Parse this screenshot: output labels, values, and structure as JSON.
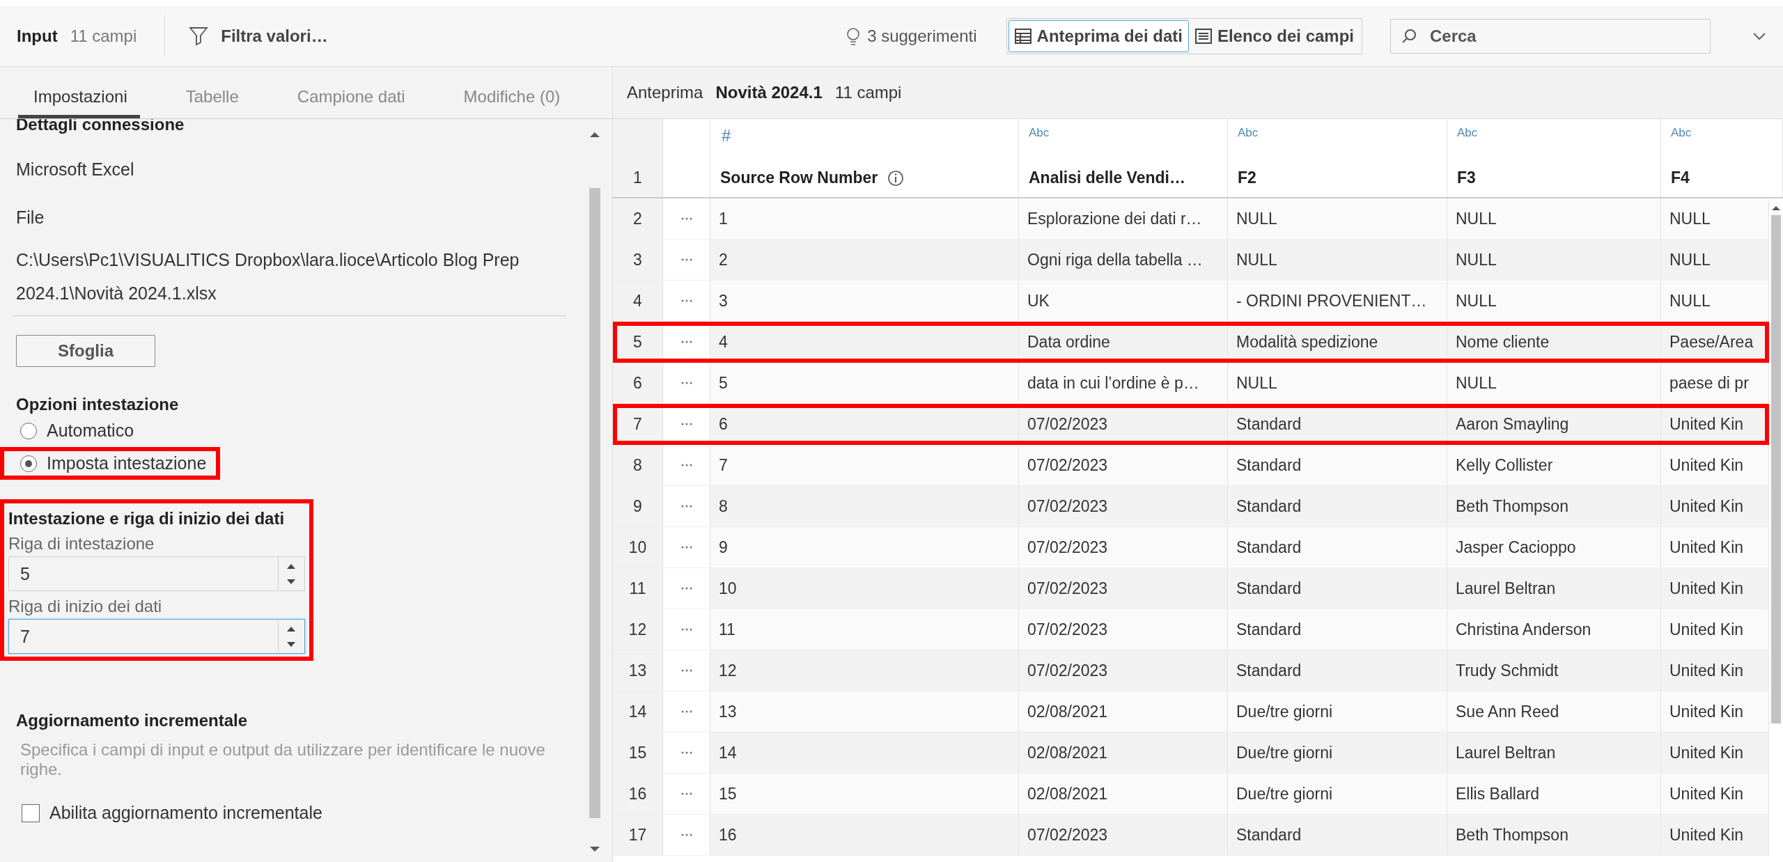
{
  "toolbar": {
    "title": "Input",
    "field_count": "11 campi",
    "filter": "Filtra valori…",
    "suggestions": "3 suggerimenti",
    "view_buttons": [
      {
        "label": "Anteprima dei dati",
        "selected": true
      },
      {
        "label": "Elenco dei campi",
        "selected": false
      }
    ],
    "search": {
      "placeholder": "Cerca"
    }
  },
  "settings_panel": {
    "tabs": [
      {
        "label": "Impostazioni",
        "selected": true
      },
      {
        "label": "Tabelle",
        "selected": false
      },
      {
        "label": "Campione dati",
        "selected": false
      },
      {
        "label": "Modifiche (0)",
        "selected": false
      }
    ],
    "section_heading": "Dettagli connessione",
    "connection_type": "Microsoft Excel",
    "file_label": "File",
    "file_path": "C:\\Users\\Pc1\\VISUALITICS Dropbox\\lara.lioce\\Articolo Blog Prep 2024.1\\Novità 2024.1.xlsx",
    "browse_button": "Sfoglia",
    "header_options": {
      "title": "Opzioni intestazione",
      "options": [
        {
          "label": "Automatico",
          "selected": false,
          "highlighted": false
        },
        {
          "label": "Imposta intestazione",
          "selected": true,
          "highlighted": true
        }
      ]
    },
    "header_rows": {
      "title": "Intestazione e riga di inizio dei dati",
      "highlighted": true,
      "fields": [
        {
          "label": "Riga di intestazione",
          "value": "5",
          "focused": false
        },
        {
          "label": "Riga di inizio dei dati",
          "value": "7",
          "focused": true
        }
      ]
    },
    "incremental": {
      "title": "Aggiornamento incrementale",
      "description": "Specifica i campi di input e output da utilizzare per identificare le nuove righe.",
      "checkbox": {
        "label": "Abilita aggiornamento incrementale",
        "checked": false
      }
    }
  },
  "preview": {
    "label": "Anteprima",
    "table_name": "Novità 2024.1",
    "field_count": "11 campi",
    "table": {
      "header_row_number": "1",
      "columns": [
        {
          "type_label": "#",
          "name": "Source Row Number",
          "info": true
        },
        {
          "type_label": "Abc",
          "name": "Analisi delle Vendi…",
          "info": false
        },
        {
          "type_label": "Abc",
          "name": "F2",
          "info": false
        },
        {
          "type_label": "Abc",
          "name": "F3",
          "info": false
        },
        {
          "type_label": "Abc",
          "name": "F4",
          "info": false
        }
      ],
      "rows": [
        {
          "row_number": "2",
          "highlighted": false,
          "cells": [
            "1",
            "Esplorazione dei dati r…",
            "NULL",
            "NULL",
            "NULL"
          ]
        },
        {
          "row_number": "3",
          "highlighted": false,
          "cells": [
            "2",
            "Ogni riga della tabella …",
            "NULL",
            "NULL",
            "NULL"
          ]
        },
        {
          "row_number": "4",
          "highlighted": false,
          "cells": [
            "3",
            "UK",
            "- ORDINI PROVENIENT…",
            "NULL",
            "NULL"
          ]
        },
        {
          "row_number": "5",
          "highlighted": true,
          "cells": [
            "4",
            "Data ordine",
            "Modalità spedizione",
            "Nome cliente",
            "Paese/Area"
          ]
        },
        {
          "row_number": "6",
          "highlighted": false,
          "cells": [
            "5",
            "data in cui l’ordine è p…",
            "NULL",
            "NULL",
            "paese di pr"
          ]
        },
        {
          "row_number": "7",
          "highlighted": true,
          "cells": [
            "6",
            "07/02/2023",
            "Standard",
            "Aaron Smayling",
            "United Kin"
          ]
        },
        {
          "row_number": "8",
          "highlighted": false,
          "cells": [
            "7",
            "07/02/2023",
            "Standard",
            "Kelly Collister",
            "United Kin"
          ]
        },
        {
          "row_number": "9",
          "highlighted": false,
          "cells": [
            "8",
            "07/02/2023",
            "Standard",
            "Beth Thompson",
            "United Kin"
          ]
        },
        {
          "row_number": "10",
          "highlighted": false,
          "cells": [
            "9",
            "07/02/2023",
            "Standard",
            "Jasper Cacioppo",
            "United Kin"
          ]
        },
        {
          "row_number": "11",
          "highlighted": false,
          "cells": [
            "10",
            "07/02/2023",
            "Standard",
            "Laurel Beltran",
            "United Kin"
          ]
        },
        {
          "row_number": "12",
          "highlighted": false,
          "cells": [
            "11",
            "07/02/2023",
            "Standard",
            "Christina Anderson",
            "United Kin"
          ]
        },
        {
          "row_number": "13",
          "highlighted": false,
          "cells": [
            "12",
            "07/02/2023",
            "Standard",
            "Trudy Schmidt",
            "United Kin"
          ]
        },
        {
          "row_number": "14",
          "highlighted": false,
          "cells": [
            "13",
            "02/08/2021",
            "Due/tre giorni",
            "Sue Ann Reed",
            "United Kin"
          ]
        },
        {
          "row_number": "15",
          "highlighted": false,
          "cells": [
            "14",
            "02/08/2021",
            "Due/tre giorni",
            "Laurel Beltran",
            "United Kin"
          ]
        },
        {
          "row_number": "16",
          "highlighted": false,
          "cells": [
            "15",
            "02/08/2021",
            "Due/tre giorni",
            "Ellis Ballard",
            "United Kin"
          ]
        },
        {
          "row_number": "17",
          "highlighted": false,
          "cells": [
            "16",
            "07/02/2023",
            "Standard",
            "Beth Thompson",
            "United Kin"
          ]
        }
      ]
    }
  }
}
